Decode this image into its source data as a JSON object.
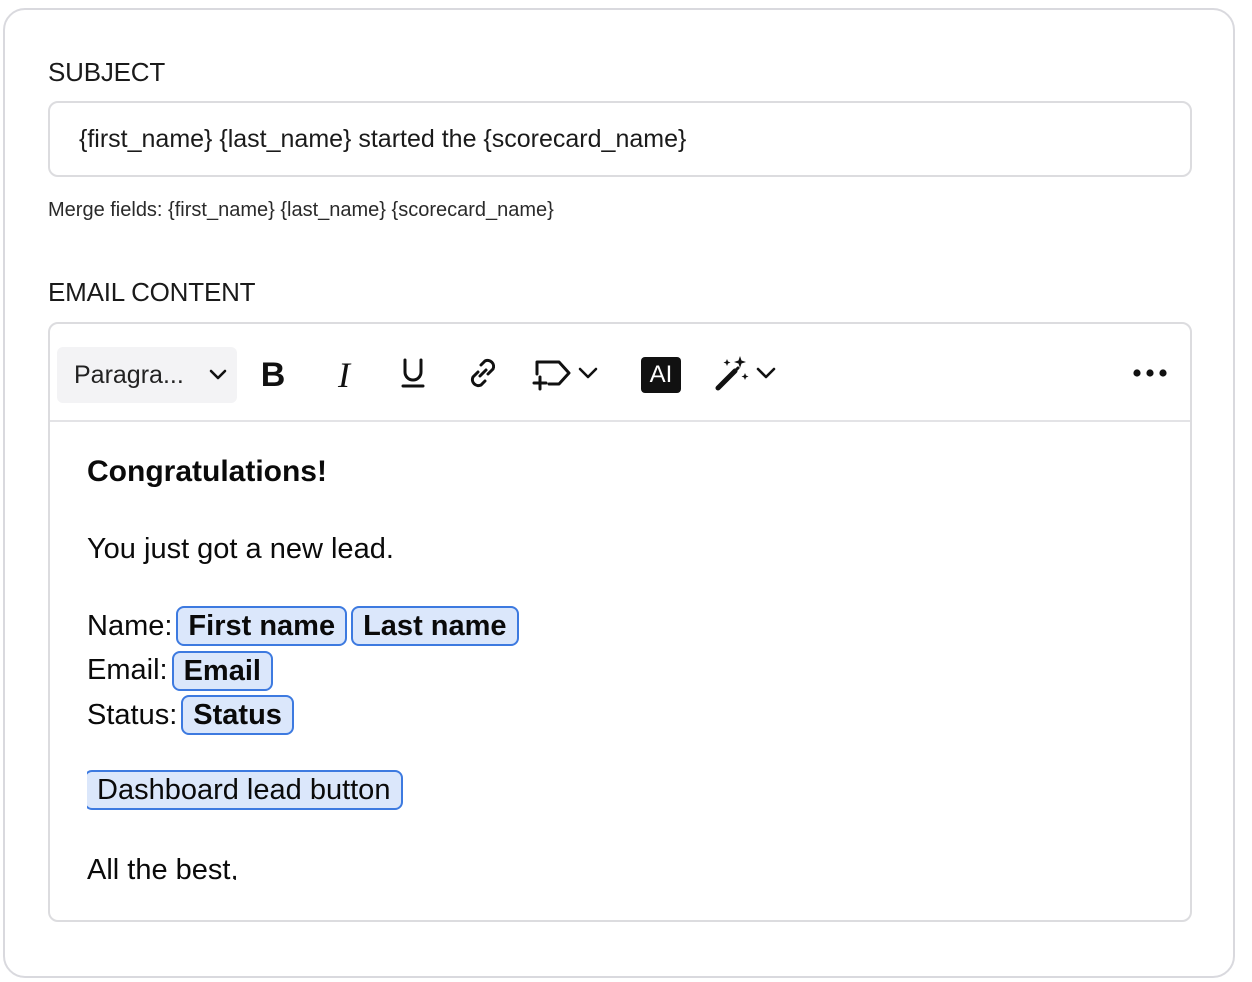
{
  "subject": {
    "label": "SUBJECT",
    "value": "{first_name} {last_name} started the {scorecard_name}",
    "merge_hint": "Merge fields: {first_name} {last_name} {scorecard_name}"
  },
  "email_content": {
    "label": "EMAIL CONTENT",
    "toolbar": {
      "paragraph_select": "Paragra...",
      "bold": "B",
      "italic": "I",
      "ai": "AI"
    },
    "body": {
      "heading": "Congratulations!",
      "intro": "You just got a new lead.",
      "name_label": "Name:",
      "first_name_chip": "First name",
      "last_name_chip": "Last name",
      "email_label": "Email:",
      "email_chip": "Email",
      "status_label": "Status:",
      "status_chip": "Status",
      "dashboard_button": "Dashboard lead button",
      "sign_off": "All the best,"
    }
  },
  "colors": {
    "chip_bg": "#dbe7fb",
    "chip_border": "#3d7ae0",
    "border": "#dcdcdf"
  }
}
